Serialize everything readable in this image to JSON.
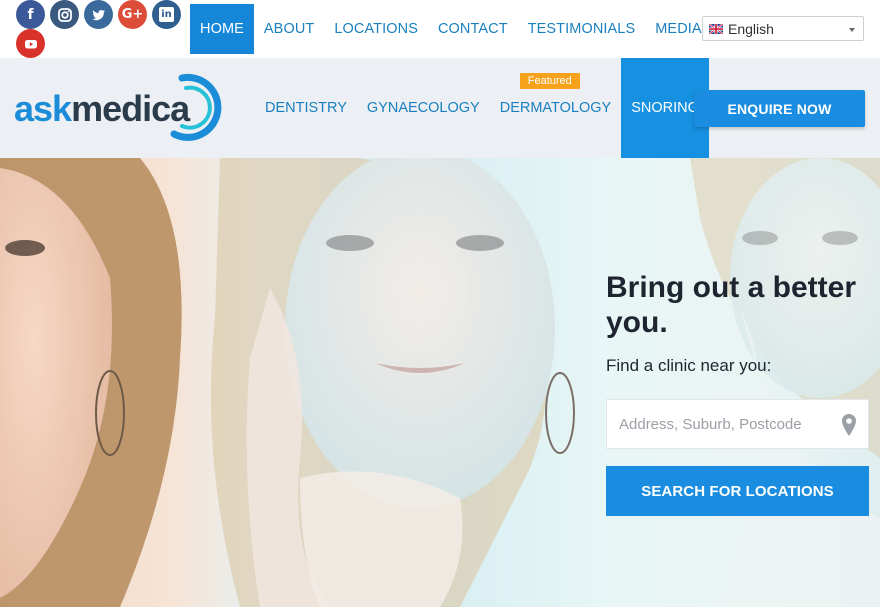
{
  "social": {
    "facebook": "f",
    "googleplus": "G+",
    "linkedin": "in"
  },
  "topnav": {
    "items": [
      "HOME",
      "ABOUT",
      "LOCATIONS",
      "CONTACT",
      "TESTIMONIALS",
      "MEDIA"
    ],
    "active": "HOME"
  },
  "language": {
    "selected": "English",
    "icon": "uk-flag-icon"
  },
  "brand": {
    "part1": "ask",
    "part2": "medica",
    "color_primary": "#1a8cd8",
    "color_dark": "#2a3b4c"
  },
  "mainnav": {
    "items": [
      "DENTISTRY",
      "GYNAECOLOGY",
      "DERMATOLOGY",
      "SNORING"
    ],
    "badge": "Featured",
    "active": "SNORING",
    "cta": "ENQUIRE NOW"
  },
  "hero": {
    "title": "Bring out a better you.",
    "subtitle": "Find a clinic near you:",
    "search_placeholder": "Address, Suburb, Postcode",
    "search_button": "SEARCH FOR LOCATIONS"
  },
  "colors": {
    "accent": "#1a8de0",
    "badge": "#f7a21b"
  }
}
